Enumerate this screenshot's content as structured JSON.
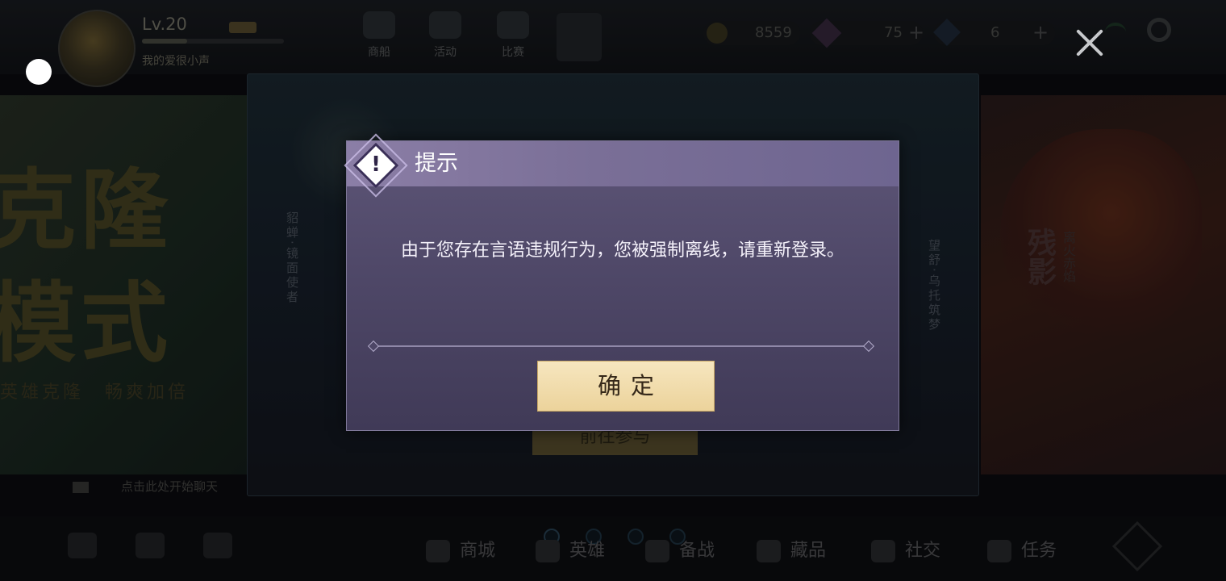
{
  "profile": {
    "level": "Lv.20",
    "nickname": "我的爱很小声"
  },
  "top_nav": [
    {
      "label": "商船"
    },
    {
      "label": "活动"
    },
    {
      "label": "比赛"
    }
  ],
  "currency": [
    {
      "value": "8559"
    },
    {
      "value": "75"
    },
    {
      "value": "6"
    }
  ],
  "promo_left": {
    "line1": "克隆",
    "line2": "模式",
    "subtitle": "英雄克隆　畅爽加倍"
  },
  "promo_center": {
    "left_vertical": "貂蝉·镜面使者",
    "right_vertical": "望舒·乌托筑梦",
    "button": "前往参与"
  },
  "promo_right": {
    "big": "残影",
    "small": "离火赤焰"
  },
  "hint": {
    "text": "点击此处开始聊天"
  },
  "bottom_nav": [
    {
      "label": "商城"
    },
    {
      "label": "英雄"
    },
    {
      "label": "备战"
    },
    {
      "label": "藏品"
    },
    {
      "label": "社交"
    },
    {
      "label": "任务"
    }
  ],
  "dialog": {
    "title": "提示",
    "message": "由于您存在言语违规行为，您被强制离线，请重新登录。",
    "confirm_label": "确定"
  },
  "colors": {
    "dialog_bg": "#4f4868",
    "dialog_header": "#7a6f97",
    "confirm_bg": "#ecd39b",
    "confirm_text": "#352819"
  }
}
